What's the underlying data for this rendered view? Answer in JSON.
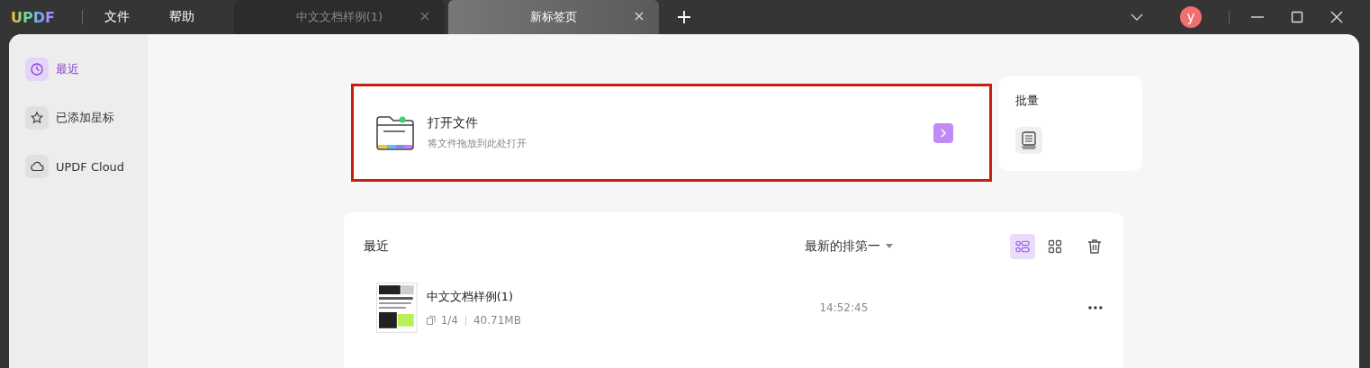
{
  "app": {
    "logo": "UPDF",
    "menu": [
      "文件",
      "帮助"
    ]
  },
  "tabs": [
    {
      "label": "中文文档样例(1)",
      "selected": false
    },
    {
      "label": "新标签页",
      "selected": true
    }
  ],
  "account": {
    "avatar": "y"
  },
  "sidebar": {
    "items": [
      {
        "label": "最近",
        "selected": true
      },
      {
        "label": "已添加星标",
        "selected": false
      },
      {
        "label": "UPDF Cloud",
        "selected": false
      }
    ]
  },
  "open_file": {
    "title": "打开文件",
    "subtitle": "将文件拖放到此处打开"
  },
  "batch": {
    "title": "批量"
  },
  "recent": {
    "title": "最近",
    "sort": "最新的排第一",
    "views": [
      {
        "selected": true
      },
      {
        "selected": false
      }
    ],
    "files": [
      {
        "name": "中文文档样例(1)",
        "pages": "1/4",
        "size": "40.71MB",
        "time": "14:52:45"
      }
    ]
  }
}
